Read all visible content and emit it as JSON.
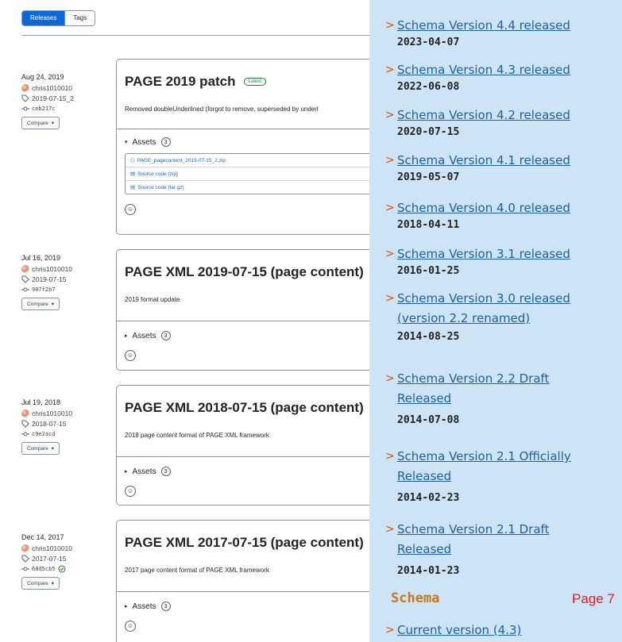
{
  "tabs": {
    "releases": "Releases",
    "tags": "Tags"
  },
  "releases": [
    {
      "date": "Aug 24, 2019",
      "author": "chris1010010",
      "tag": "2019-07-15_2",
      "commit": "ceb217c",
      "compare": "Compare",
      "title": "PAGE 2019 patch",
      "badge": "Latest",
      "desc": "Removed doubleUnderlined (forgot to remove, superseded by underl",
      "assets_label": "Assets",
      "assets_count": "3",
      "assets": [
        "PAGE_pagecontent_2019-07-15_2.zip",
        "Source code (zip)",
        "Source code (tar.gz)"
      ]
    },
    {
      "date": "Jul 16, 2019",
      "author": "chris1010010",
      "tag": "2019-07-15",
      "commit": "907f2b7",
      "compare": "Compare",
      "title": "PAGE XML 2019-07-15 (page content)",
      "badge": "",
      "desc": "2019 format update",
      "assets_label": "Assets",
      "assets_count": "3",
      "assets": []
    },
    {
      "date": "Jul 19, 2018",
      "author": "chris1010010",
      "tag": "2018-07-15",
      "commit": "c9e2acd",
      "compare": "Compare",
      "title": "PAGE XML 2018-07-15 (page content)",
      "badge": "",
      "desc": "2018 page content format of PAGE XML framework",
      "assets_label": "Assets",
      "assets_count": "3",
      "assets": []
    },
    {
      "date": "Dec 14, 2017",
      "author": "chris1010010",
      "tag": "2017-07-15",
      "commit": "68d5cb5",
      "compare": "Compare",
      "title": "PAGE XML 2017-07-15 (page content)",
      "badge": "",
      "desc": "2017 page content format of PAGE XML framework",
      "assets_label": "Assets",
      "assets_count": "3",
      "assets": []
    }
  ],
  "news": [
    {
      "lines": [
        "Schema Version 4.4 released"
      ],
      "date": "2023-04-07"
    },
    {
      "lines": [
        "Schema Version 4.3 released"
      ],
      "date": "2022-06-08"
    },
    {
      "lines": [
        "Schema Version 4.2 released"
      ],
      "date": "2020-07-15"
    },
    {
      "lines": [
        "Schema Version 4.1 released"
      ],
      "date": "2019-05-07"
    },
    {
      "lines": [
        "Schema Version 4.0 released"
      ],
      "date": "2018-04-11"
    },
    {
      "lines": [
        "Schema Version 3.1 released"
      ],
      "date": "2016-01-25"
    },
    {
      "lines": [
        "Schema Version 3.0 released",
        "(version 2.2 renamed)"
      ],
      "date": "2014-08-25"
    },
    {
      "lines": [
        "Schema Version 2.2 Draft",
        "Released"
      ],
      "date": "2014-07-08"
    },
    {
      "lines": [
        "Schema Version 2.1 Officially",
        "Released"
      ],
      "date": "2014-02-23"
    },
    {
      "lines": [
        "Schema Version 2.1 Draft",
        "Released"
      ],
      "date": "2014-01-23"
    }
  ],
  "schema_heading": "Schema",
  "page_label": "Page 7",
  "current_version_link": "Current version (4.3)"
}
